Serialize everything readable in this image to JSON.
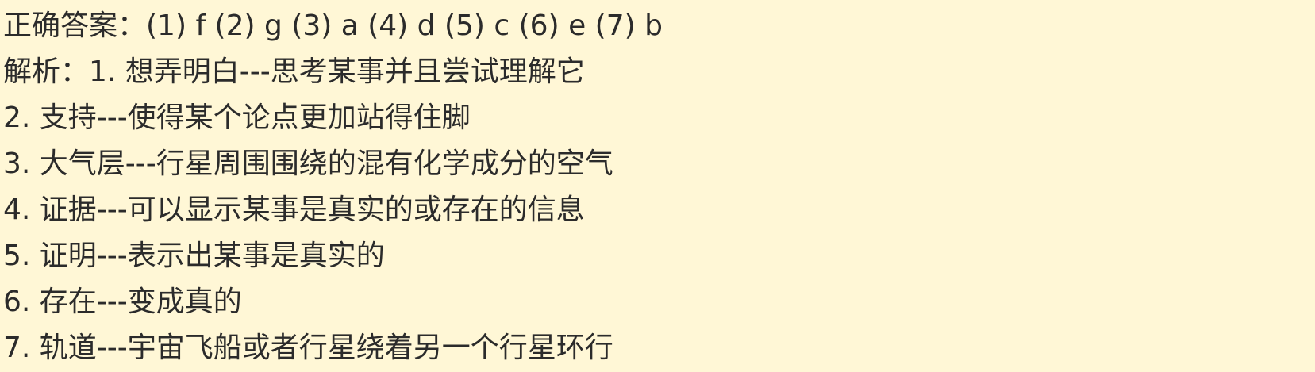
{
  "answer": "正确答案：(1) f (2) g (3) a (4) d (5) c (6) e (7) b",
  "analysis_lines": [
    "解析：1. 想弄明白---思考某事并且尝试理解它",
    "2. 支持---使得某个论点更加站得住脚",
    "3. 大气层---行星周围围绕的混有化学成分的空气",
    "4. 证据---可以显示某事是真实的或存在的信息",
    "5. 证明---表示出某事是真实的",
    "6. 存在---变成真的",
    "7. 轨道---宇宙飞船或者行星绕着另一个行星环行"
  ]
}
